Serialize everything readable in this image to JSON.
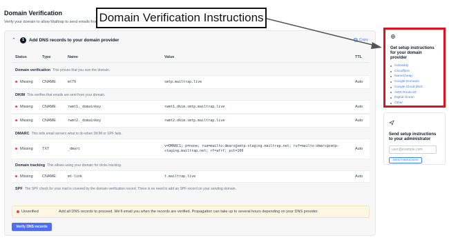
{
  "page": {
    "title": "Domain Verification",
    "subtitle": "Verify your domain to allow Mailtrap to send emails from"
  },
  "callout": {
    "text": "Domain Verification Instructions"
  },
  "accordion": {
    "step": "1",
    "title": "Add DNS records to your domain provider",
    "copy_label": "Copy"
  },
  "table": {
    "headers": {
      "status": "Status",
      "type": "Type",
      "name": "Name",
      "value": "Value",
      "ttl": "TTL"
    },
    "sections": {
      "domain_verification": {
        "title": "Domain verification",
        "desc": "This proves that you own the domain."
      },
      "dkim": {
        "title": "DKIM",
        "desc": "This verifies that emails are sent from your domain."
      },
      "dmarc": {
        "title": "DMARC",
        "desc": "This tells email servers what to do when DKIM or SPF fails."
      },
      "domain_tracking": {
        "title": "Domain tracking",
        "desc": "This allows using your domain for clicks tracking."
      },
      "spf": {
        "title": "SPF",
        "desc": "The SPF check for your mail is covered by the domain verification record. There is no need to add an SPF record on your sending domain."
      }
    },
    "rows": [
      {
        "status": "Missing",
        "type": "CNAME",
        "name": "mt79",
        "value": "smtp.mailtrap.live",
        "ttl": "Auto"
      },
      {
        "status": "Missing",
        "type": "CNAME",
        "name": "rwmt1._domainkey",
        "value": "rwmt1.dkim.smtp.mailtrap.live",
        "ttl": "Auto"
      },
      {
        "status": "Missing",
        "type": "CNAME",
        "name": "rwmt2._domainkey",
        "value": "rwmt2.dkim.smtp.mailtrap.live",
        "ttl": "Auto"
      },
      {
        "status": "Missing",
        "type": "TXT",
        "name": "_dmarc",
        "value_line1": "v=DMARC1; p=none; rua=mailto:dmarc@smtp-staging.mailtrap.net; ruf=mailto:dmarc@smtp-",
        "value_line2": "staging.mailtrap.net; rf=afrf; pct=100",
        "ttl": "Auto"
      },
      {
        "status": "Missing",
        "type": "CNAME",
        "name": "mt-link",
        "value": "t.mailtrap.live",
        "ttl": "Auto"
      }
    ]
  },
  "banner": {
    "status": "Unverified",
    "message": "Add all DNS records to proceed. We'll email you when the records are verified. Propagation can take up to several hours depending on your DNS provider."
  },
  "verify_button": "Verify DNS records",
  "help": {
    "icon": "gear-icon",
    "title": "Get setup instructions for your domain provider",
    "providers": [
      "GoDaddy",
      "Cloudflare",
      "Namecheap",
      "Google Domains",
      "Google Cloud DNS",
      "AWS Route 53",
      "Digital Ocean",
      "Other"
    ]
  },
  "send": {
    "icon": "send-icon",
    "title": "Send setup instructions to your administrator",
    "placeholder": "user@example.com",
    "button": "Send Instructions"
  },
  "colors": {
    "accent": "#4f6ff0",
    "link": "#3b82f6",
    "missing": "#ef4444",
    "highlight": "#e0101e"
  }
}
